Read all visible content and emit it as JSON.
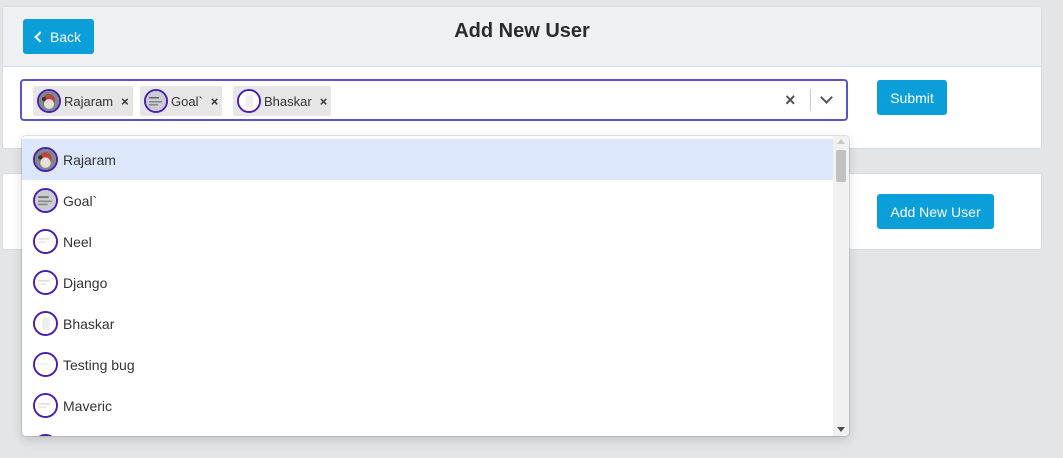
{
  "header": {
    "back_label": "Back",
    "title": "Add New User"
  },
  "select": {
    "chips": [
      {
        "label": "Rajaram",
        "avatar": "rajaram-avatar-icon",
        "remove": "×"
      },
      {
        "label": "Goal`",
        "avatar": "goal-avatar-icon",
        "remove": "×"
      },
      {
        "label": "Bhaskar",
        "avatar": "bhaskar-avatar-icon",
        "remove": "×"
      }
    ],
    "clear_glyph": "×",
    "focus_color": "#5a54c8"
  },
  "submit_label": "Submit",
  "add_user_label": "Add New User",
  "dropdown": {
    "options": [
      {
        "label": "Rajaram",
        "avatar": "rajaram-avatar-icon",
        "focused": true
      },
      {
        "label": "Goal`",
        "avatar": "goal-avatar-icon"
      },
      {
        "label": "Neel",
        "avatar": "neel-avatar-icon"
      },
      {
        "label": "Django",
        "avatar": "django-avatar-icon"
      },
      {
        "label": "Bhaskar",
        "avatar": "bhaskar-avatar-icon"
      },
      {
        "label": "Testing bug",
        "avatar": "testing-bug-avatar-icon"
      },
      {
        "label": "Maveric",
        "avatar": "maveric-avatar-icon"
      }
    ]
  },
  "colors": {
    "primary": "#0a9fd8",
    "option_focus": "#dde7fc",
    "avatar_border": "#4a1fb0"
  }
}
